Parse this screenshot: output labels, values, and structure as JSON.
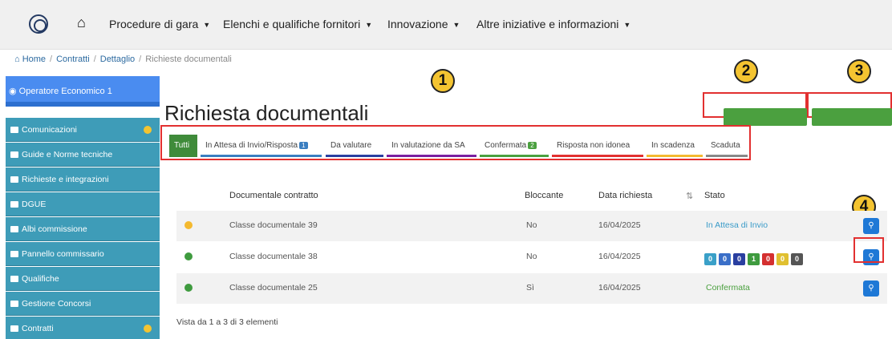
{
  "nav": {
    "menu": [
      {
        "label": "Procedure di gara"
      },
      {
        "label": "Elenchi e qualifiche fornitori"
      },
      {
        "label": "Innovazione"
      },
      {
        "label": "Altre iniziative e informazioni"
      }
    ]
  },
  "breadcrumb": [
    "Home",
    "Contratti",
    "Dettaglio",
    "Richieste documentali"
  ],
  "sidebar": {
    "user": "Operatore Economico 1",
    "items": [
      {
        "label": "Comunicazioni",
        "badge_dot": true
      },
      {
        "label": "Guide e Norme tecniche",
        "badge_dot": false
      },
      {
        "label": "Richieste e integrazioni",
        "badge_dot": false
      },
      {
        "label": "DGUE",
        "badge_dot": false
      },
      {
        "label": "Albi commissione",
        "badge_dot": false
      },
      {
        "label": "Pannello commissario",
        "badge_dot": false
      },
      {
        "label": "Qualifiche",
        "badge_dot": false
      },
      {
        "label": "Gestione Concorsi",
        "badge_dot": false
      },
      {
        "label": "Contratti",
        "badge_dot": true
      }
    ]
  },
  "main": {
    "title": "Richiesta documentali",
    "callouts": [
      "1",
      "2",
      "3",
      "4"
    ],
    "tabs": [
      {
        "label": "Tutti",
        "badge": ""
      },
      {
        "label": "In Attesa di Invio/Risposta",
        "badge": "1"
      },
      {
        "label": "Da valutare",
        "badge": ""
      },
      {
        "label": "In valutazione da SA",
        "badge": ""
      },
      {
        "label": "Confermata",
        "badge": "2"
      },
      {
        "label": "Risposta non idonea",
        "badge": ""
      },
      {
        "label": "In scadenza",
        "badge": ""
      },
      {
        "label": "Scaduta",
        "badge": ""
      }
    ],
    "table": {
      "headers": {
        "documentale": "Documentale contratto",
        "bloccante": "Bloccante",
        "data": "Data richiesta",
        "stato": "Stato"
      },
      "rows": [
        {
          "documentale": "Classe documentale 39",
          "bloccante": "No",
          "data": "16/04/2025",
          "stato": "In Attesa di Invio",
          "dot_color": "#f4b92f"
        },
        {
          "documentale": "Classe documentale 38",
          "bloccante": "No",
          "data": "16/04/2025",
          "stato": "",
          "dot_color": "#3f9b3f",
          "status_counts": [
            "0",
            "0",
            "0",
            "1",
            "0",
            "0",
            "0"
          ]
        },
        {
          "documentale": "Classe documentale 25",
          "bloccante": "Sì",
          "data": "16/04/2025",
          "stato": "Confermata",
          "dot_color": "#3f9b3f"
        }
      ]
    },
    "footer": "Vista da 1 a 3 di 3 elementi"
  },
  "colors": {
    "accent": "#3e9cb8",
    "success": "#4ba03f",
    "callout": "#f4c431",
    "highlight": "#e23030",
    "info": "#3a7ec0"
  }
}
